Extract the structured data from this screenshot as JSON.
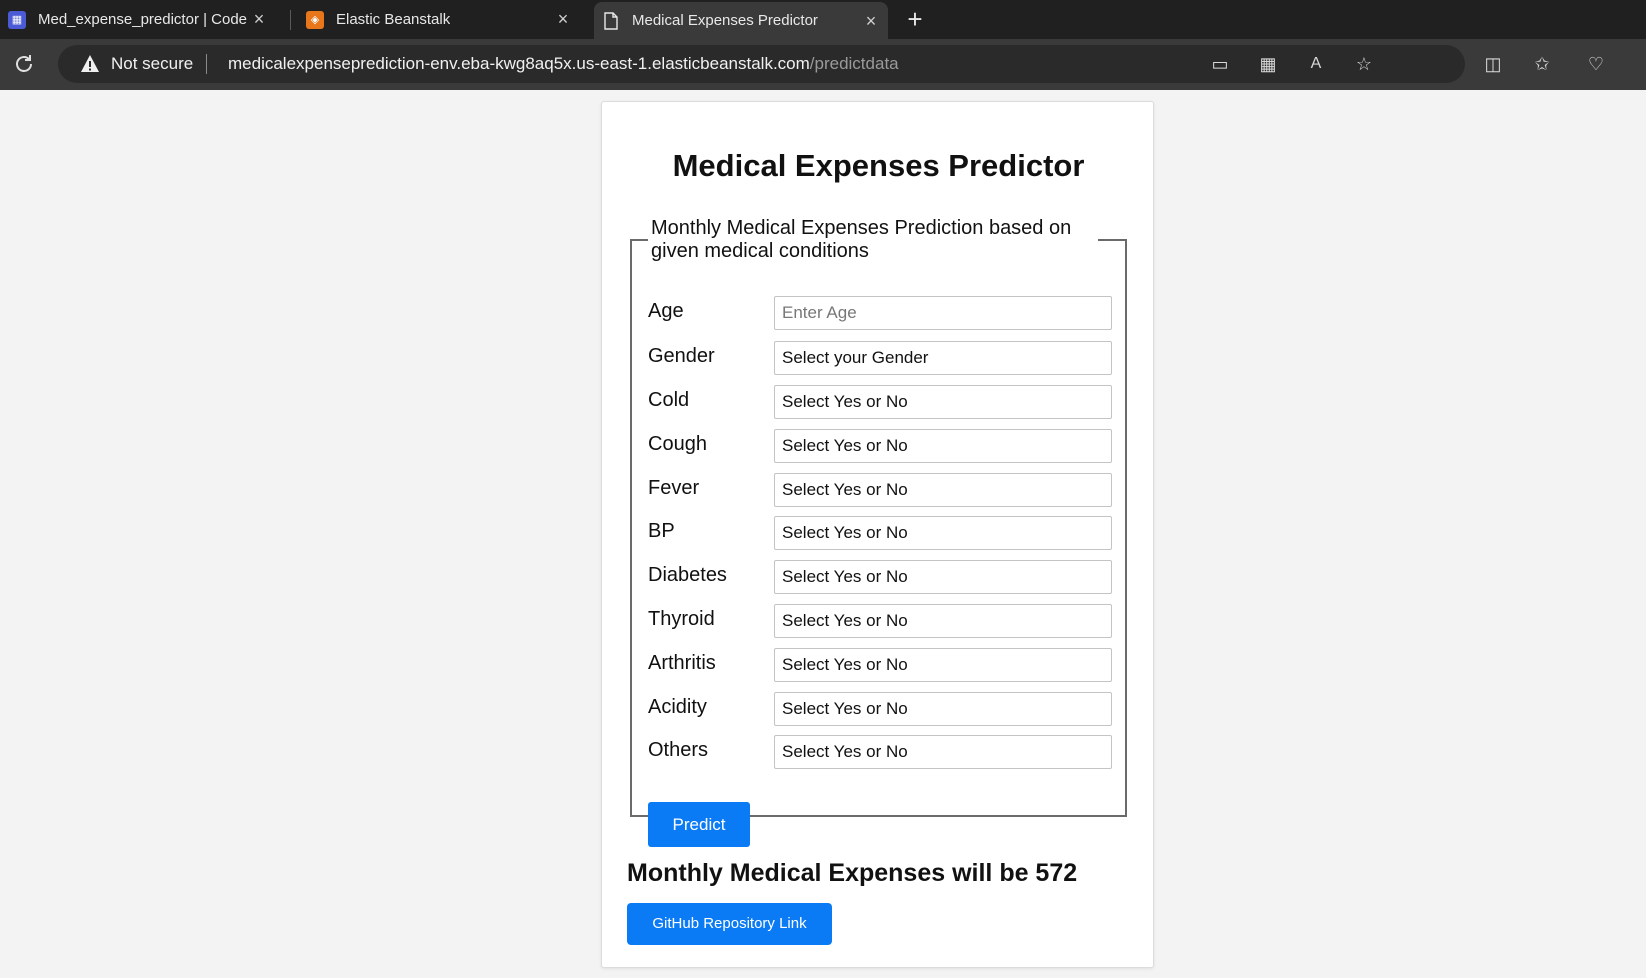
{
  "browser": {
    "tabs": [
      {
        "title": "Med_expense_predictor | CodePi",
        "icon": "codepipeline-icon"
      },
      {
        "title": "Elastic Beanstalk",
        "icon": "elastic-beanstalk-icon"
      },
      {
        "title": "Medical Expenses Predictor",
        "icon": "page-icon"
      }
    ],
    "security_label": "Not secure",
    "url_host": "medicalexpenseprediction-env.eba-kwg8aq5x.us-east-1.elasticbeanstalk.com",
    "url_path": "/predictdata"
  },
  "page": {
    "title": "Medical Expenses Predictor",
    "legend": "Monthly Medical Expenses Prediction based on given medical conditions",
    "fields": [
      {
        "label": "Age",
        "value": "Enter Age"
      },
      {
        "label": "Gender",
        "value": "Select your Gender"
      },
      {
        "label": "Cold",
        "value": "Select Yes or No"
      },
      {
        "label": "Cough",
        "value": "Select Yes or No"
      },
      {
        "label": "Fever",
        "value": "Select Yes or No"
      },
      {
        "label": "BP",
        "value": "Select Yes or No"
      },
      {
        "label": "Diabetes",
        "value": "Select Yes or No"
      },
      {
        "label": "Thyroid",
        "value": "Select Yes or No"
      },
      {
        "label": "Arthritis",
        "value": "Select Yes or No"
      },
      {
        "label": "Acidity",
        "value": "Select Yes or No"
      },
      {
        "label": "Others",
        "value": "Select Yes or No"
      }
    ],
    "predict_label": "Predict",
    "result_text": "Monthly Medical Expenses will be 572",
    "github_label": "GitHub Repository Link"
  },
  "colors": {
    "button_blue": "#0a7bf5"
  }
}
